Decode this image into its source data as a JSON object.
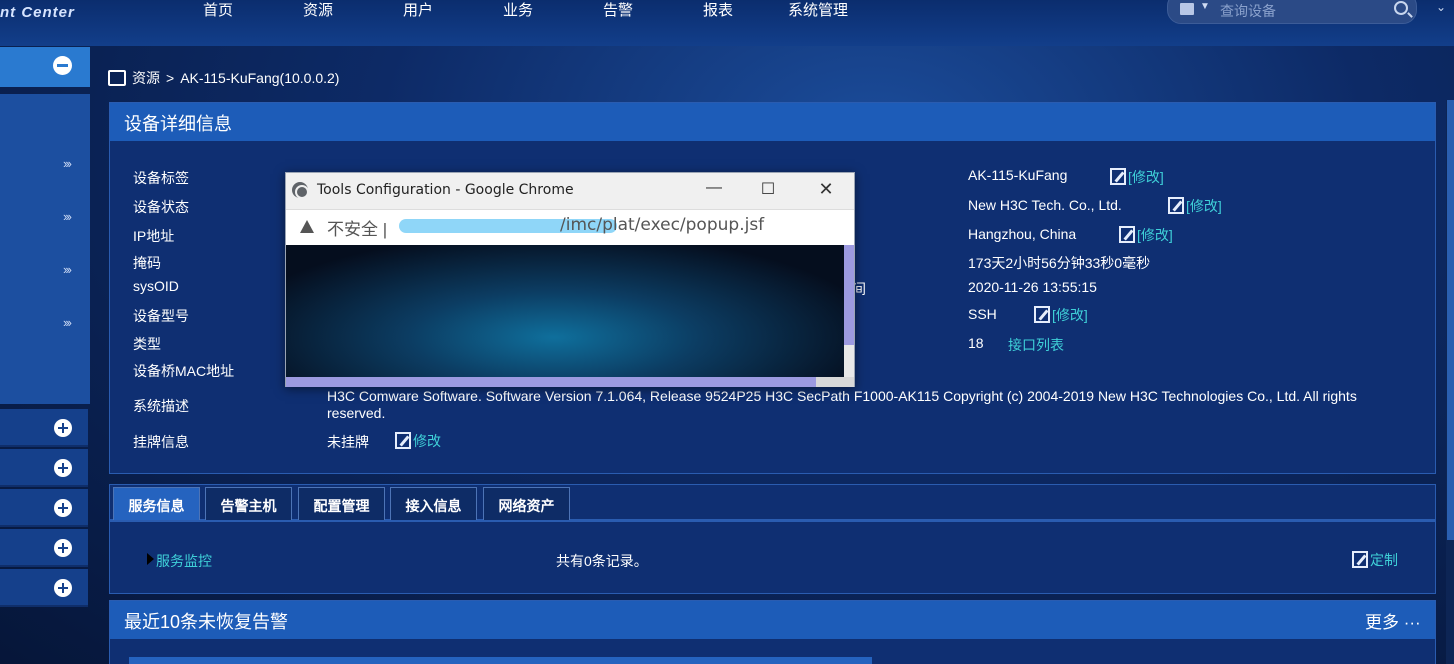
{
  "topbar": {
    "logo": "nt Center",
    "nav": [
      "首页",
      "资源",
      "用户",
      "业务",
      "告警",
      "报表",
      "系统管理"
    ],
    "search_placeholder": "查询设备"
  },
  "breadcrumb": {
    "root": "资源",
    "sep": ">",
    "current": "AK-115-KuFang(10.0.0.2)"
  },
  "device_panel": {
    "title": "设备详细信息",
    "left_labels": [
      "设备标签",
      "设备状态",
      "IP地址",
      "掩码",
      "sysOID",
      "设备型号",
      "类型",
      "设备桥MAC地址",
      "系统描述",
      "挂牌信息"
    ],
    "partial_overlap_text": "间",
    "right_values": [
      {
        "value": "AK-115-KuFang",
        "action": "[修改]"
      },
      {
        "value": "New H3C Tech. Co., Ltd.",
        "action": "[修改]"
      },
      {
        "value": "Hangzhou, China",
        "action": "[修改]"
      },
      {
        "value": "173天2小时56分钟33秒0毫秒",
        "action": ""
      },
      {
        "value": "2020-11-26 13:55:15",
        "action": ""
      },
      {
        "value": "SSH",
        "action": "[修改]"
      },
      {
        "value": "18",
        "action": "接口列表"
      }
    ],
    "system_description": "H3C Comware Software. Software Version 7.1.064, Release 9524P25 H3C SecPath F1000-AK115 Copyright (c) 2004-2019 New H3C Technologies Co., Ltd. All rights reserved.",
    "tag_value": "未挂牌",
    "tag_action": "修改"
  },
  "tabs": {
    "items": [
      "服务信息",
      "告警主机",
      "配置管理",
      "接入信息",
      "网络资产"
    ],
    "active": "服务信息",
    "service_monitor": "服务监控",
    "record_count": "共有0条记录。",
    "customize": "定制"
  },
  "alarms_panel": {
    "title": "最近10条未恢复告警",
    "more": "更多"
  },
  "popup": {
    "title": "Tools Configuration - Google Chrome",
    "insecure_label": "不安全",
    "url_visible": "/imc/plat/exec/popup.jsf"
  }
}
